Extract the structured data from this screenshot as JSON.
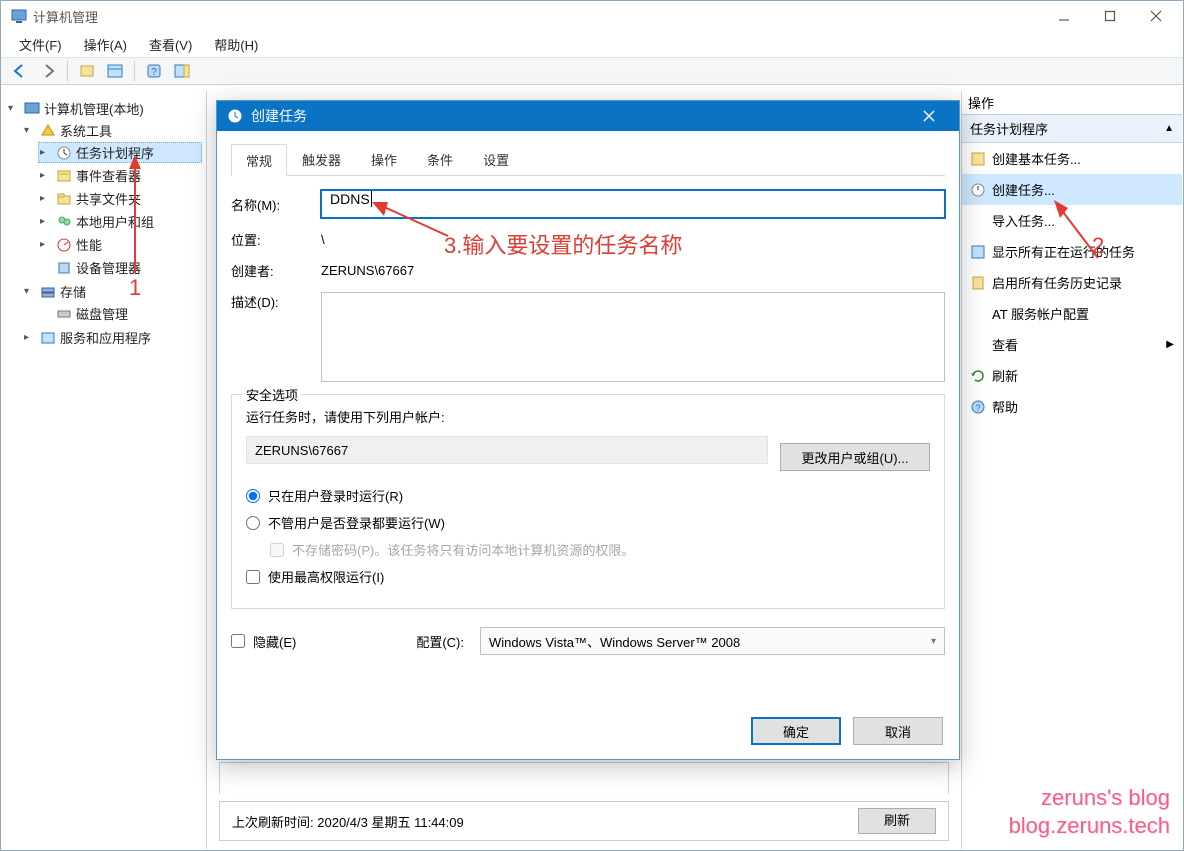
{
  "window": {
    "title": "计算机管理",
    "sysbuttons": {
      "min": "—",
      "max": "▢",
      "close": "✕"
    }
  },
  "menu": {
    "file": "文件(F)",
    "action": "操作(A)",
    "view": "查看(V)",
    "help": "帮助(H)"
  },
  "tree": {
    "root": "计算机管理(本地)",
    "system_tools": "系统工具",
    "task_scheduler": "任务计划程序",
    "event_viewer": "事件查看器",
    "shared_folders": "共享文件夹",
    "local_users": "本地用户和组",
    "performance": "性能",
    "device_manager": "设备管理器",
    "storage": "存储",
    "disk_mgmt": "磁盘管理",
    "services_apps": "服务和应用程序"
  },
  "center": {
    "last_refresh_label": "上次刷新时间:",
    "last_refresh_value": "2020/4/3 星期五 11:44:09",
    "truncated_row": "…",
    "refresh_btn": "刷新"
  },
  "actions": {
    "header": "操作",
    "section": "任务计划程序",
    "items": [
      "创建基本任务...",
      "创建任务...",
      "导入任务...",
      "显示所有正在运行的任务",
      "启用所有任务历史记录",
      "AT 服务帐户配置",
      "查看",
      "刷新",
      "帮助"
    ]
  },
  "dialog": {
    "title": "创建任务",
    "tabs": {
      "general": "常规",
      "triggers": "触发器",
      "actions": "操作",
      "conditions": "条件",
      "settings": "设置"
    },
    "labels": {
      "name": "名称(M):",
      "location": "位置:",
      "creator": "创建者:",
      "description": "描述(D):",
      "security": "安全选项",
      "run_as_prompt": "运行任务时，请使用下列用户帐户:",
      "change_user": "更改用户或组(U)...",
      "radio_logged": "只在用户登录时运行(R)",
      "radio_always": "不管用户是否登录都要运行(W)",
      "nopass": "不存储密码(P)。该任务将只有访问本地计算机资源的权限。",
      "highest": "使用最高权限运行(I)",
      "hidden": "隐藏(E)",
      "config": "配置(C):",
      "config_value": "Windows Vista™、Windows Server™ 2008",
      "ok": "确定",
      "cancel": "取消"
    },
    "values": {
      "name": "DDNS",
      "location": "\\",
      "creator": "ZERUNS\\67667",
      "user": "ZERUNS\\67667"
    }
  },
  "annotations": {
    "num1": "1",
    "num2": "2",
    "step3": "3.输入要设置的任务名称"
  },
  "watermark": {
    "line1": "zeruns's blog",
    "line2": "blog.zeruns.tech"
  }
}
